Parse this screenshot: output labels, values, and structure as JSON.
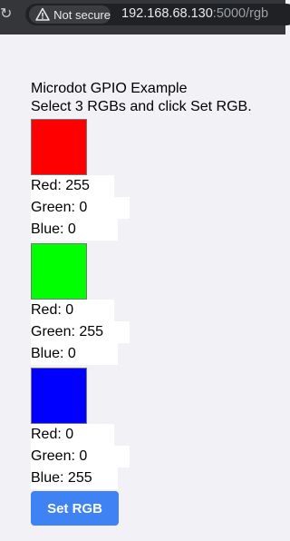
{
  "browser": {
    "security_label": "Not secure",
    "url_host": "192.168.68.130",
    "url_rest": ":5000/rgb",
    "icons": {
      "reload": "reload-icon",
      "warning": "warning-icon"
    }
  },
  "page": {
    "heading": "Microdot GPIO Example",
    "instructions": "Select 3 RGBs and click Set RGB.",
    "colors": [
      {
        "swatch_color": "#ff0000",
        "red": "Red: 255",
        "green": "Green: 0",
        "blue": "Blue: 0"
      },
      {
        "swatch_color": "#00ff00",
        "red": "Red: 0",
        "green": "Green: 255",
        "blue": "Blue: 0"
      },
      {
        "swatch_color": "#0000ff",
        "red": "Red: 0",
        "green": "Green: 0",
        "blue": "Blue: 255"
      }
    ],
    "button_label": "Set RGB",
    "button_color": "#3f82f3"
  }
}
